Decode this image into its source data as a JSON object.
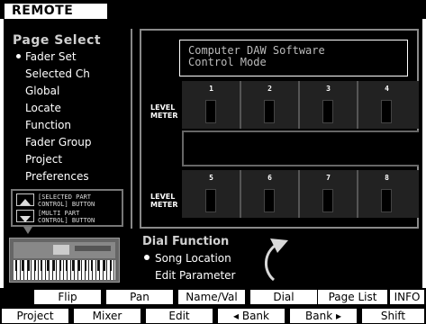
{
  "title": "REMOTE",
  "page_select": {
    "title": "Page Select",
    "items": [
      {
        "label": "Fader Set",
        "selected": true
      },
      {
        "label": "Selected Ch",
        "selected": false
      },
      {
        "label": "Global",
        "selected": false
      },
      {
        "label": "Locate",
        "selected": false
      },
      {
        "label": "Function",
        "selected": false
      },
      {
        "label": "Fader Group",
        "selected": false
      },
      {
        "label": "Project",
        "selected": false
      },
      {
        "label": "Preferences",
        "selected": false
      }
    ]
  },
  "hardware_buttons": {
    "selected_part_line1": "[SELECTED PART",
    "selected_part_line2": " CONTROL] BUTTON",
    "multi_part_line1": "[MULTI PART",
    "multi_part_line2": " CONTROL] BUTTON"
  },
  "display": {
    "line1": "Computer DAW Software",
    "line2": "Control Mode",
    "meter_label_line1": "LEVEL",
    "meter_label_line2": "METER",
    "channels_top": [
      "1",
      "2",
      "3",
      "4"
    ],
    "channels_bottom": [
      "5",
      "6",
      "7",
      "8"
    ]
  },
  "dial_function": {
    "title": "Dial Function",
    "items": [
      {
        "label": "Song Location",
        "selected": true
      },
      {
        "label": "Edit Parameter",
        "selected": false
      }
    ]
  },
  "function_buttons": [
    "Flip",
    "Pan",
    "Name/Val",
    "Dial",
    "Page List",
    "INFO"
  ],
  "sub_buttons": [
    "Project",
    "Mixer",
    "Edit",
    "◂ Bank",
    "Bank ▸",
    "Shift"
  ],
  "icons": {
    "arrow": "curved-arrow-icon",
    "up": "triangle-up-icon",
    "down": "triangle-down-icon"
  }
}
